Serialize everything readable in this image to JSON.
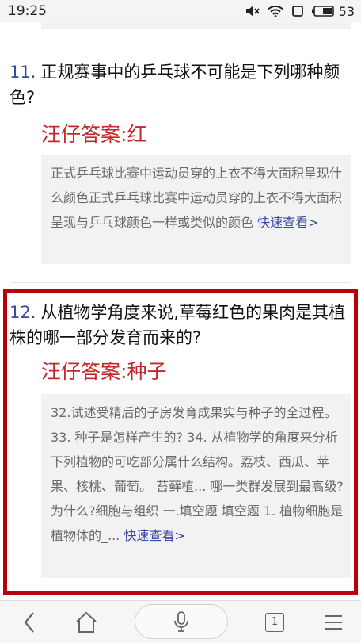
{
  "status_bar": {
    "time": "19:25",
    "battery": "53"
  },
  "items": [
    {
      "number": "11.",
      "question": "正规赛事中的乒乓球不可能是下列哪种颜色?",
      "answer_label": "汪仔答案:",
      "answer_value": "红",
      "snippet": "正式乒乓球比赛中运动员穿的上衣不得大面积呈现什么颜色正式乒乓球比赛中运动员穿的上衣不得大面积呈现与乒乓球颜色一样或类似的颜色",
      "more_label": "快速查看>"
    },
    {
      "number": "12.",
      "question": "从植物学角度来说,草莓红色的果肉是其植株的哪一部分发育而来的?",
      "answer_label": "汪仔答案:",
      "answer_value": "种子",
      "snippet": "32.试述受精后的子房发育成果实与种子的全过程。 33. 种子是怎样产生的? 34. 从植物学的角度来分析下列植物的可吃部分属什么结构。荔枝、西瓜、苹果、核桃、葡萄。 苔藓植... 哪一类群发展到最高级?为什么?细胞与组织 一.填空题 填空题 1. 植物细胞是植物体的_...",
      "more_label": "快速查看>"
    }
  ],
  "bottom_nav": {
    "tab_count": "1"
  },
  "colors": {
    "highlight_border": "#b8000b",
    "answer": "#c0282b",
    "link": "#3a4a9f"
  }
}
